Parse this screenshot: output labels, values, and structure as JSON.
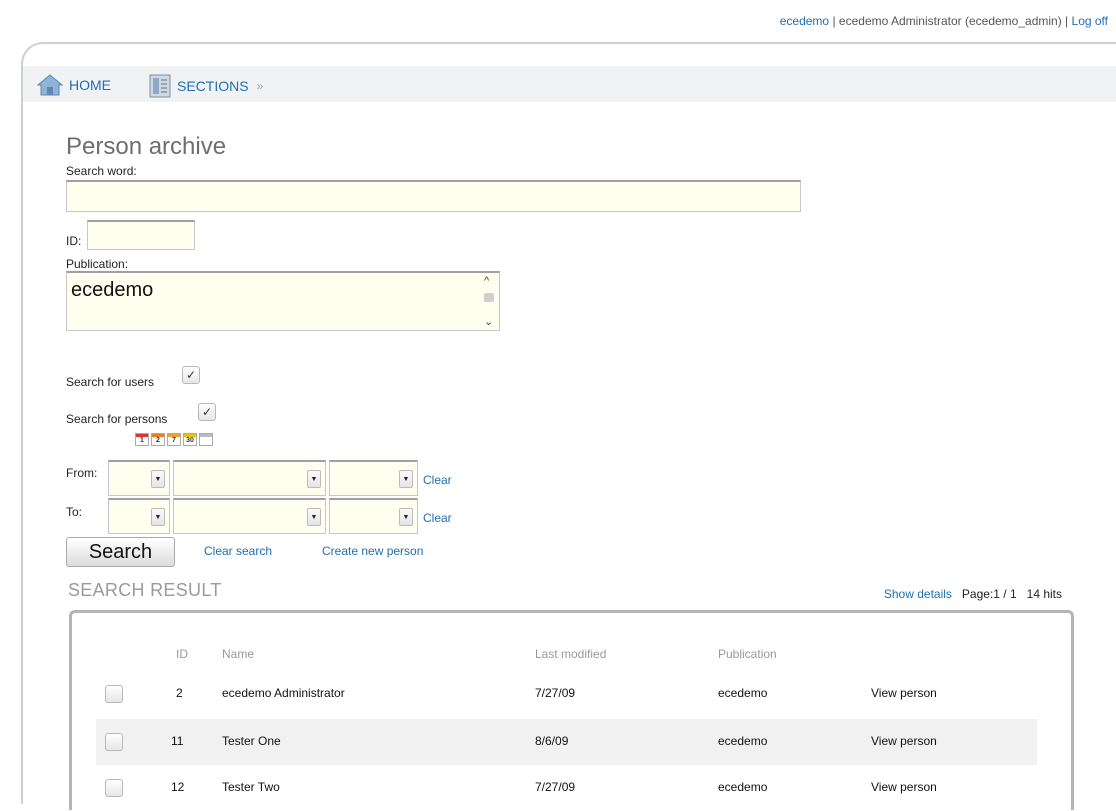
{
  "topbar": {
    "user_link": "ecedemo",
    "user_info": "ecedemo Administrator (ecedemo_admin)",
    "separator": "|",
    "logoff": "Log off"
  },
  "nav": {
    "home": "HOME",
    "sections": "SECTIONS",
    "sections_sep": "»"
  },
  "page": {
    "title": "Person archive"
  },
  "form": {
    "search_word_label": "Search word:",
    "search_word_value": "",
    "id_label": "ID:",
    "id_value": "",
    "publication_label": "Publication:",
    "publication_selected": "ecedemo",
    "search_users_label": "Search for users",
    "search_users_checked": true,
    "search_persons_label": "Search for persons",
    "search_persons_checked": true,
    "calendar_shortcuts": [
      "1",
      "2",
      "7",
      "30",
      ""
    ],
    "from_label": "From:",
    "to_label": "To:",
    "clear_label": "Clear",
    "search_button": "Search",
    "clear_search": "Clear search",
    "create_new": "Create new person"
  },
  "results": {
    "title": "SEARCH RESULT",
    "show_details": "Show details",
    "page_info": "Page:1 / 1",
    "hits": "14 hits",
    "columns": {
      "id": "ID",
      "name": "Name",
      "last_modified": "Last modified",
      "publication": "Publication"
    },
    "rows": [
      {
        "id": "2",
        "name": "ecedemo Administrator",
        "last_modified": "7/27/09",
        "publication": "ecedemo",
        "action": "View person"
      },
      {
        "id": "11",
        "name": "Tester One",
        "last_modified": "8/6/09",
        "publication": "ecedemo",
        "action": "View person"
      },
      {
        "id": "12",
        "name": "Tester Two",
        "last_modified": "7/27/09",
        "publication": "ecedemo",
        "action": "View person"
      }
    ]
  }
}
